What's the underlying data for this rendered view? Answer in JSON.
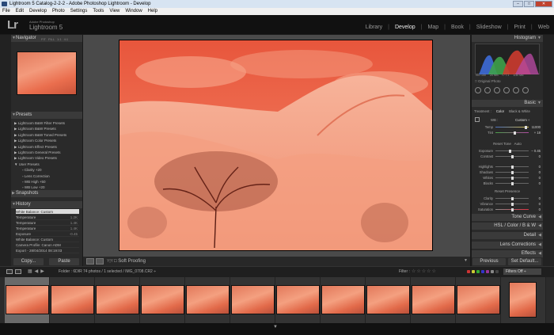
{
  "window": {
    "title": "Lightroom 5 Catalog-2-2-2 - Adobe Photoshop Lightroom - Develop",
    "controls": [
      "–",
      "□",
      "✕"
    ]
  },
  "menu": [
    "File",
    "Edit",
    "Develop",
    "Photo",
    "Settings",
    "Tools",
    "View",
    "Window",
    "Help"
  ],
  "identity": {
    "logo": "Lr",
    "adobe": "Adobe Photoshop",
    "product": "Lightroom 5"
  },
  "modules": [
    "Library",
    "Develop",
    "Map",
    "Book",
    "Slideshow",
    "Print",
    "Web"
  ],
  "active_module": "Develop",
  "left": {
    "navigator": {
      "title": "Navigator",
      "zoom": [
        "FIT",
        "FILL",
        "1:1",
        "4:1"
      ]
    },
    "presets": {
      "title": "Presets",
      "items": [
        "Lightroom B&W Filter Presets",
        "Lightroom B&W Presets",
        "Lightroom B&W Toned Presets",
        "Lightroom Color Presets",
        "Lightroom Effect Presets",
        "Lightroom General Presets",
        "Lightroom Video Presets",
        "User Presets",
        "Clarity +20",
        "Lens Correction",
        "WB High +50",
        "WB Low +20"
      ]
    },
    "snapshots": {
      "title": "Snapshots"
    },
    "history": {
      "title": "History",
      "items": [
        {
          "name": "White Balance: Custom",
          "val": ""
        },
        {
          "name": "Temperature",
          "val": "1.2K"
        },
        {
          "name": "Temperature",
          "val": "1.4K"
        },
        {
          "name": "Temperature",
          "val": "1.4K"
        },
        {
          "name": "Exposure",
          "val": "-0.45"
        },
        {
          "name": "White Balance: Custom",
          "val": ""
        },
        {
          "name": "Camera Profile: Canon ADM",
          "val": ""
        },
        {
          "name": "Export - 28/04/2014 08:19:03",
          "val": ""
        }
      ]
    },
    "copy": "Copy...",
    "paste": "Paste"
  },
  "toolbar": {
    "softproof": "Soft Proofing",
    "yy": "Y|Y"
  },
  "right": {
    "histogram": {
      "title": "Histogram",
      "values": [
        "ISO 100",
        "24 mm",
        "f / 7.1",
        "1/30 sec"
      ],
      "original": "Original Photo"
    },
    "basic": {
      "title": "Basic",
      "treatment_label": "Treatment :",
      "color": "Color",
      "bw": "Black & White",
      "wb_label": "WB :",
      "wb_value": "Custom ÷",
      "temp": {
        "label": "Temp",
        "val": "11000",
        "pos": 0.92
      },
      "tint": {
        "label": "Tint",
        "val": "+ 18",
        "pos": 0.58
      },
      "tone_header": "Reset Tone",
      "auto": "Auto",
      "tone": [
        {
          "label": "Exposure",
          "val": "– 0.45",
          "pos": 0.45
        },
        {
          "label": "Contrast",
          "val": "0",
          "pos": 0.5
        },
        {
          "label": "Highlights",
          "val": "0",
          "pos": 0.5
        },
        {
          "label": "Shadows",
          "val": "0",
          "pos": 0.5
        },
        {
          "label": "Whites",
          "val": "0",
          "pos": 0.5
        },
        {
          "label": "Blacks",
          "val": "0",
          "pos": 0.5
        }
      ],
      "presence_header": "Reset Presence",
      "presence": [
        {
          "label": "Clarity",
          "val": "0",
          "pos": 0.5
        },
        {
          "label": "Vibrance",
          "val": "0",
          "pos": 0.5
        },
        {
          "label": "Saturation",
          "val": "0",
          "pos": 0.5
        }
      ]
    },
    "panels": [
      "Tone Curve",
      "HSL / Color / B & W",
      "Detail",
      "Lens Corrections",
      "Effects"
    ],
    "previous": "Previous",
    "reset": "Set Default..."
  },
  "filmbar": {
    "source": "Folder : 6DIR",
    "count": "74 photos / 1 selected / IMG_0708.CR2 ÷",
    "filter": "Filter :",
    "stars": "☆☆☆☆☆",
    "filters_off": "Filters Off ÷"
  },
  "colors": {
    "photo_red": "#e8644a",
    "accent": "#dcdcdc",
    "filter_colors": [
      "#c33",
      "#cc3",
      "#3a3",
      "#33c",
      "#939",
      "#888",
      "#444"
    ]
  }
}
